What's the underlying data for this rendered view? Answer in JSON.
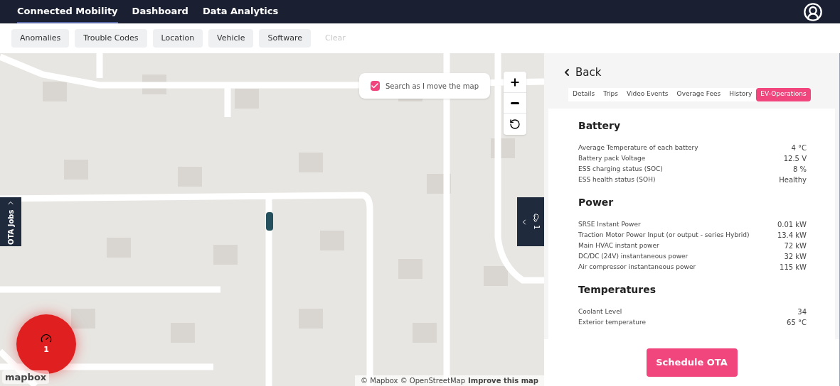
{
  "nav": {
    "items": [
      {
        "label": "Connected Mobility",
        "selected": true
      },
      {
        "label": "Dashboard",
        "selected": false
      },
      {
        "label": "Data Analytics",
        "selected": false
      }
    ]
  },
  "filters": [
    {
      "label": "Anomalies",
      "disabled": false
    },
    {
      "label": "Trouble Codes",
      "disabled": false
    },
    {
      "label": "Location",
      "disabled": false
    },
    {
      "label": "Vehicle",
      "disabled": false
    },
    {
      "label": "Software",
      "disabled": false
    },
    {
      "label": "Clear",
      "disabled": true
    }
  ],
  "map": {
    "kind": "picture",
    "search_toggle": {
      "label": "Search as I move the map",
      "checked": true
    },
    "left_tab": {
      "label": "OTA Jobs"
    },
    "right_tab": {
      "count": "1"
    },
    "cluster": {
      "count": "1"
    },
    "logo": "mapbox",
    "attribution": "© Mapbox © OpenStreetMap",
    "improve_link": "Improve this map"
  },
  "panel": {
    "back": "Back",
    "tabs": [
      {
        "label": "Details",
        "selected": false
      },
      {
        "label": "Trips",
        "selected": false
      },
      {
        "label": "Video Events",
        "selected": false
      },
      {
        "label": "Overage Fees",
        "selected": false
      },
      {
        "label": "History",
        "selected": false
      },
      {
        "label": "EV-Operations",
        "selected": true
      }
    ],
    "sections": [
      {
        "title": "Battery",
        "rows": [
          {
            "label": "Average Temperature of each battery",
            "value": "4 °C"
          },
          {
            "label": "Battery pack Voltage",
            "value": "12.5 V"
          },
          {
            "label": "ESS charging status (SOC)",
            "value": "8 %"
          },
          {
            "label": "ESS health status (SOH)",
            "value": "Healthy"
          }
        ]
      },
      {
        "title": "Power",
        "rows": [
          {
            "label": "SRSE Instant Power",
            "value": "0.01 kW"
          },
          {
            "label": "Traction Motor Power Input (or output - series Hybrid)",
            "value": "13.4 kW"
          },
          {
            "label": "Main HVAC instant power",
            "value": "72 kW"
          },
          {
            "label": "DC/DC (24V) instantaneous power",
            "value": "32 kW"
          },
          {
            "label": "Air compressor instantaneous power",
            "value": "115 kW"
          }
        ]
      },
      {
        "title": "Temperatures",
        "rows": [
          {
            "label": "Coolant Level",
            "value": "34"
          },
          {
            "label": "Exterior temperature",
            "value": "65 °C"
          }
        ]
      }
    ],
    "action": "Schedule OTA"
  }
}
